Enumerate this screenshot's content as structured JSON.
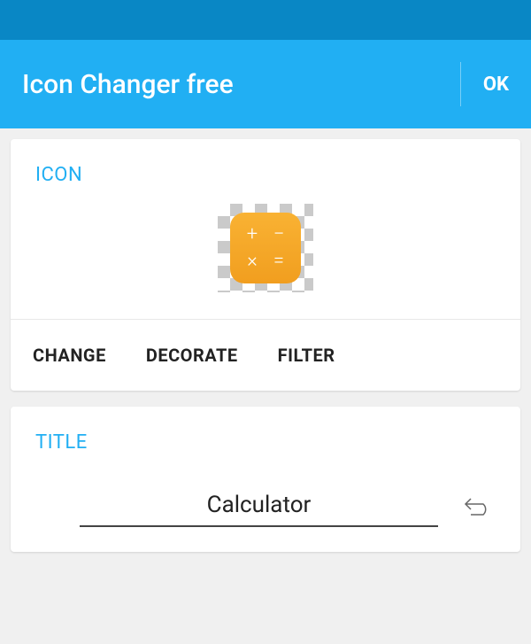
{
  "header": {
    "title": "Icon Changer free",
    "ok_label": "OK"
  },
  "icon_section": {
    "label": "ICON",
    "preview_icon": "calculator-icon",
    "actions": {
      "change": "CHANGE",
      "decorate": "DECORATE",
      "filter": "FILTER"
    }
  },
  "title_section": {
    "label": "TITLE",
    "value": "Calculator"
  },
  "colors": {
    "status_bar": "#0987c5",
    "app_bar": "#21aff3",
    "accent": "#21aff3",
    "icon_orange": "#f9b233"
  }
}
